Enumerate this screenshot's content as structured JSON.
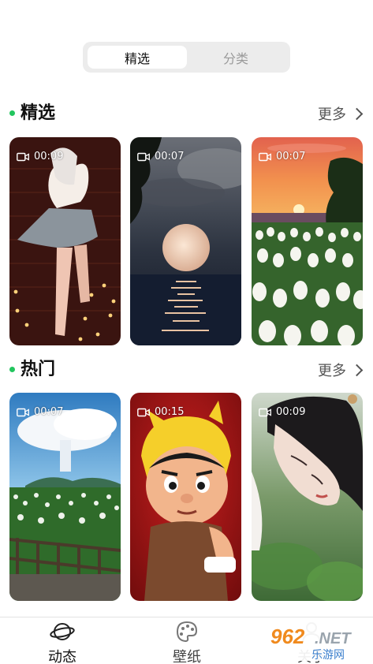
{
  "segment": {
    "tabs": [
      {
        "label": "精选"
      },
      {
        "label": "分类"
      }
    ]
  },
  "accent": "#22c55e",
  "sections": [
    {
      "title": "精选",
      "more": "更多",
      "cards": [
        {
          "duration": "00:09",
          "icon": "video-camera-icon"
        },
        {
          "duration": "00:07",
          "icon": "video-camera-icon"
        },
        {
          "duration": "00:07",
          "icon": "video-camera-icon"
        }
      ]
    },
    {
      "title": "热门",
      "more": "更多",
      "cards": [
        {
          "duration": "00:07",
          "icon": "video-camera-icon"
        },
        {
          "duration": "00:15",
          "icon": "video-camera-icon"
        },
        {
          "duration": "00:09",
          "icon": "video-camera-icon"
        }
      ]
    }
  ],
  "tabbar": {
    "items": [
      {
        "label": "动态",
        "icon": "planet-icon"
      },
      {
        "label": "壁纸",
        "icon": "palette-icon"
      },
      {
        "label": "关于",
        "icon": "user-icon"
      }
    ]
  },
  "watermark": {
    "logo": "962.NET",
    "text": "乐游网"
  }
}
